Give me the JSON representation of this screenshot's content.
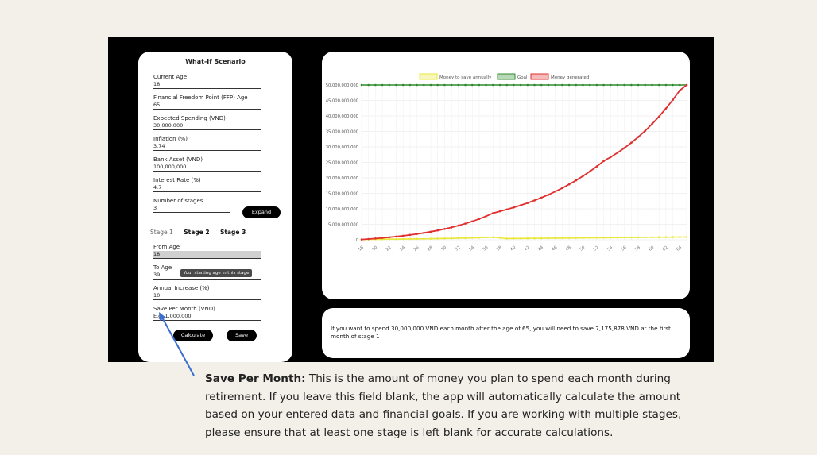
{
  "form": {
    "title": "What-If Scenario",
    "fields": [
      {
        "label": "Current Age",
        "value": "18"
      },
      {
        "label": "Financial Freedom Point (FFP) Age",
        "value": "65"
      },
      {
        "label": "Expected Spending (VND)",
        "value": "30,000,000"
      },
      {
        "label": "Inflation (%)",
        "value": "3.74"
      },
      {
        "label": "Bank Asset (VND)",
        "value": "100,000,000"
      },
      {
        "label": "Interest Rate (%)",
        "value": "4.7"
      },
      {
        "label": "Number of stages",
        "value": "3"
      }
    ],
    "expand_label": "Expand",
    "tabs": [
      "Stage 1",
      "Stage 2",
      "Stage 3"
    ],
    "stage_fields": [
      {
        "label": "From Age",
        "value": "18"
      },
      {
        "label": "To Age",
        "value": "39"
      },
      {
        "label": "Annual Increase (%)",
        "value": "10"
      },
      {
        "label": "Save Per Month (VND)",
        "placeholder": "E.g. 1,000,000"
      }
    ],
    "tooltip": "Your starting age in this stage",
    "calculate_label": "Calculate",
    "save_label": "Save"
  },
  "chart_data": {
    "type": "line",
    "x": [
      18,
      19,
      20,
      21,
      22,
      23,
      24,
      25,
      26,
      27,
      28,
      29,
      30,
      31,
      32,
      33,
      34,
      35,
      36,
      37,
      38,
      39,
      40,
      41,
      42,
      43,
      44,
      45,
      46,
      47,
      48,
      49,
      50,
      51,
      52,
      53,
      54,
      55,
      56,
      57,
      58,
      59,
      60,
      61,
      62,
      63,
      64,
      65
    ],
    "x_tick_labels": [
      "18",
      "20",
      "22",
      "24",
      "26",
      "28",
      "30",
      "32",
      "34",
      "36",
      "38",
      "40",
      "42",
      "44",
      "46",
      "48",
      "50",
      "52",
      "54",
      "56",
      "58",
      "60",
      "62",
      "64"
    ],
    "y_tick_labels": [
      "0",
      "5,000,000,000",
      "10,000,000,000",
      "15,000,000,000",
      "20,000,000,000",
      "25,000,000,000",
      "30,000,000,000",
      "35,000,000,000",
      "40,000,000,000",
      "45,000,000,000",
      "50,000,000,000"
    ],
    "ylim": [
      0,
      50000000000
    ],
    "grid": true,
    "legend_position": "top-center",
    "series": [
      {
        "name": "Money to save annually",
        "color": "#e8e83a",
        "values": [
          100000000,
          150000000,
          165000000,
          181500000,
          199650000,
          219615000,
          241576500,
          265734150,
          292307565,
          321538322,
          353692154,
          389061369,
          427967506,
          470764257,
          517840682,
          569624751,
          626587226,
          689245948,
          758170543,
          833987597,
          640000000,
          400000000,
          420000000,
          440000000,
          460000000,
          480000000,
          500000000,
          520000000,
          540000000,
          560000000,
          580000000,
          600000000,
          620000000,
          640000000,
          660000000,
          680000000,
          700000000,
          720000000,
          740000000,
          760000000,
          780000000,
          800000000,
          820000000,
          840000000,
          860000000,
          880000000,
          900000000,
          920000000
        ]
      },
      {
        "name": "Goal",
        "color": "#2e8b2e",
        "values": [
          50000000000,
          50000000000,
          50000000000,
          50000000000,
          50000000000,
          50000000000,
          50000000000,
          50000000000,
          50000000000,
          50000000000,
          50000000000,
          50000000000,
          50000000000,
          50000000000,
          50000000000,
          50000000000,
          50000000000,
          50000000000,
          50000000000,
          50000000000,
          50000000000,
          50000000000,
          50000000000,
          50000000000,
          50000000000,
          50000000000,
          50000000000,
          50000000000,
          50000000000,
          50000000000,
          50000000000,
          50000000000,
          50000000000,
          50000000000,
          50000000000,
          50000000000,
          50000000000,
          50000000000,
          50000000000,
          50000000000,
          50000000000,
          50000000000,
          50000000000,
          50000000000,
          50000000000,
          50000000000,
          50000000000,
          50000000000
        ]
      },
      {
        "name": "Money generated",
        "color": "#e03030",
        "values": [
          100000000,
          250000000,
          420000000,
          610000000,
          820000000,
          1050000000,
          1300000000,
          1580000000,
          1890000000,
          2230000000,
          2610000000,
          3030000000,
          3500000000,
          4020000000,
          4600000000,
          5240000000,
          5950000000,
          6740000000,
          7620000000,
          8600000000,
          9200000000,
          9800000000,
          10450000000,
          11150000000,
          11900000000,
          12720000000,
          13600000000,
          14550000000,
          15580000000,
          16690000000,
          17890000000,
          19180000000,
          20570000000,
          22070000000,
          23690000000,
          25430000000,
          26700000000,
          28100000000,
          29650000000,
          31350000000,
          33200000000,
          35200000000,
          37400000000,
          39800000000,
          42400000000,
          45200000000,
          48200000000,
          50000000000
        ]
      }
    ]
  },
  "result": {
    "text": "If you want to spend 30,000,000 VND each month after the age of 65, you will need to save 7,175,878 VND at the first month of stage 1"
  },
  "description": {
    "title": "Save Per Month:",
    "body": "This is the amount of money you plan to spend each month during retirement. If you leave this field blank, the app will automatically calculate the amount based on your entered data and financial goals. If you are working with multiple stages, please ensure that at least one stage is left blank for accurate calculations."
  }
}
